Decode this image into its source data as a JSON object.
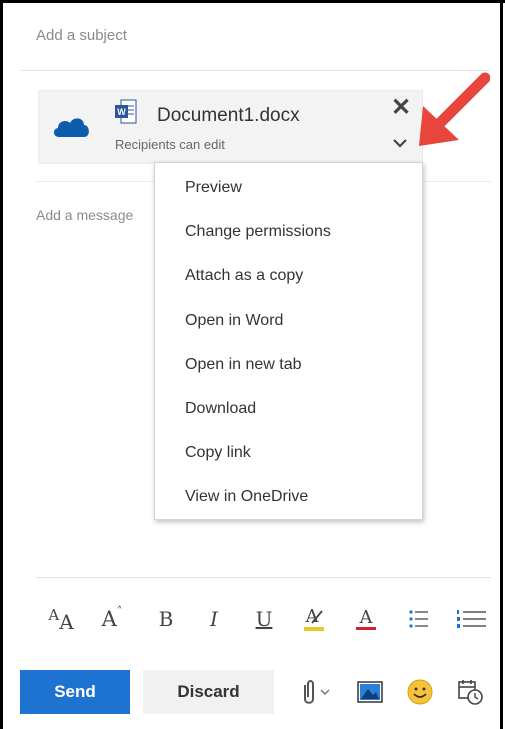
{
  "compose": {
    "subject_placeholder": "Add a subject",
    "message_placeholder": "Add a message"
  },
  "attachment": {
    "file_name": "Document1.docx",
    "permission": "Recipients can edit",
    "file_icon": "word-doc-icon",
    "cloud_icon": "onedrive-icon",
    "remove_icon": "close-icon",
    "menu_icon": "chevron-down-icon"
  },
  "menu": {
    "items": [
      {
        "label": "Preview"
      },
      {
        "label": "Change permissions"
      },
      {
        "label": "Attach as a copy"
      },
      {
        "label": "Open in Word"
      },
      {
        "label": "Open in new tab"
      },
      {
        "label": "Download"
      },
      {
        "label": "Copy link"
      },
      {
        "label": "View in OneDrive"
      }
    ]
  },
  "format_toolbar": {
    "font_size": "A",
    "font_size_small": "A",
    "grow_font": "A",
    "bold": "B",
    "italic": "I",
    "underline": "U",
    "highlight": "A",
    "font_color": "A"
  },
  "actions": {
    "send_label": "Send",
    "discard_label": "Discard"
  },
  "colors": {
    "accent": "#1e72d0",
    "arrow": "#e8453c",
    "onedrive": "#0f5cad",
    "word": "#2b579a",
    "highlight_bar": "#e8c72a",
    "font_color_bar": "#d2222f",
    "emoji": "#f6c338"
  }
}
